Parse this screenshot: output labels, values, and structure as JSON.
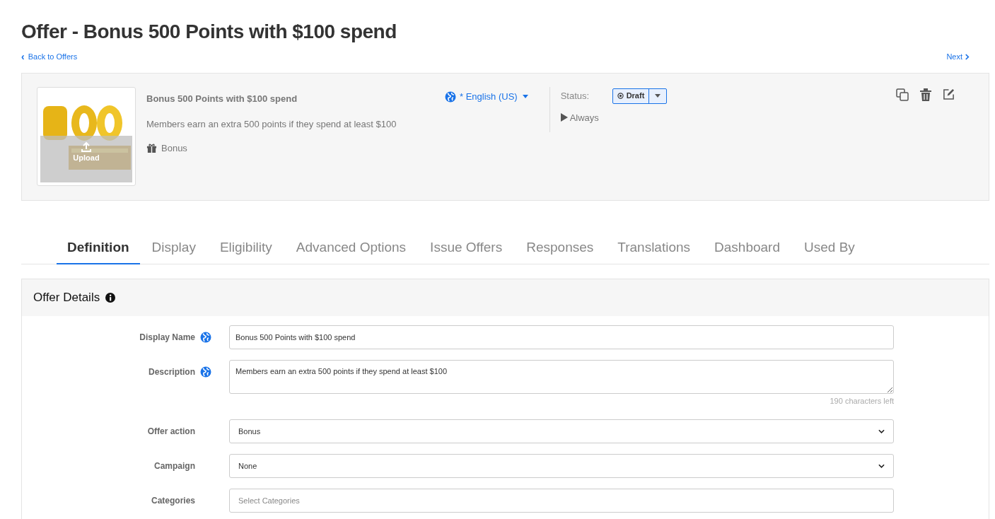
{
  "page_title": "Offer - Bonus 500 Points with $100 spend",
  "back_link": {
    "icon": "‹",
    "label": "Back to Offers"
  },
  "next_link": {
    "label": "Next"
  },
  "summary": {
    "image": {
      "kind": "picture",
      "overlay_label": "Upload"
    },
    "name": "Bonus 500 Points with $100 spend",
    "description": "Members earn an extra 500 points if they spend at least $100",
    "action": "Bonus",
    "language": "* English (US)",
    "status_label": "Status:",
    "status": "Draft",
    "schedule": "Always"
  },
  "tabs": [
    {
      "label": "Definition",
      "selected": true
    },
    {
      "label": "Display",
      "selected": false
    },
    {
      "label": "Eligibility",
      "selected": false
    },
    {
      "label": "Advanced Options",
      "selected": false
    },
    {
      "label": "Issue Offers",
      "selected": false
    },
    {
      "label": "Responses",
      "selected": false
    },
    {
      "label": "Translations",
      "selected": false
    },
    {
      "label": "Dashboard",
      "selected": false
    },
    {
      "label": "Used By",
      "selected": false
    }
  ],
  "section": {
    "title": "Offer Details",
    "fields": [
      {
        "label": "Display Name",
        "kind": "text",
        "translatable": true,
        "value": "Bonus 500 Points with $100 spend"
      },
      {
        "label": "Description",
        "kind": "textarea",
        "translatable": true,
        "value": "Members earn an extra 500 points if they spend at least $100",
        "hint": "190 characters left"
      },
      {
        "label": "Offer action",
        "kind": "select",
        "translatable": false,
        "value": "Bonus"
      },
      {
        "label": "Campaign",
        "kind": "select",
        "translatable": false,
        "value": "None"
      },
      {
        "label": "Categories",
        "kind": "multiselect",
        "translatable": false,
        "placeholder": "Select Categories"
      }
    ]
  }
}
